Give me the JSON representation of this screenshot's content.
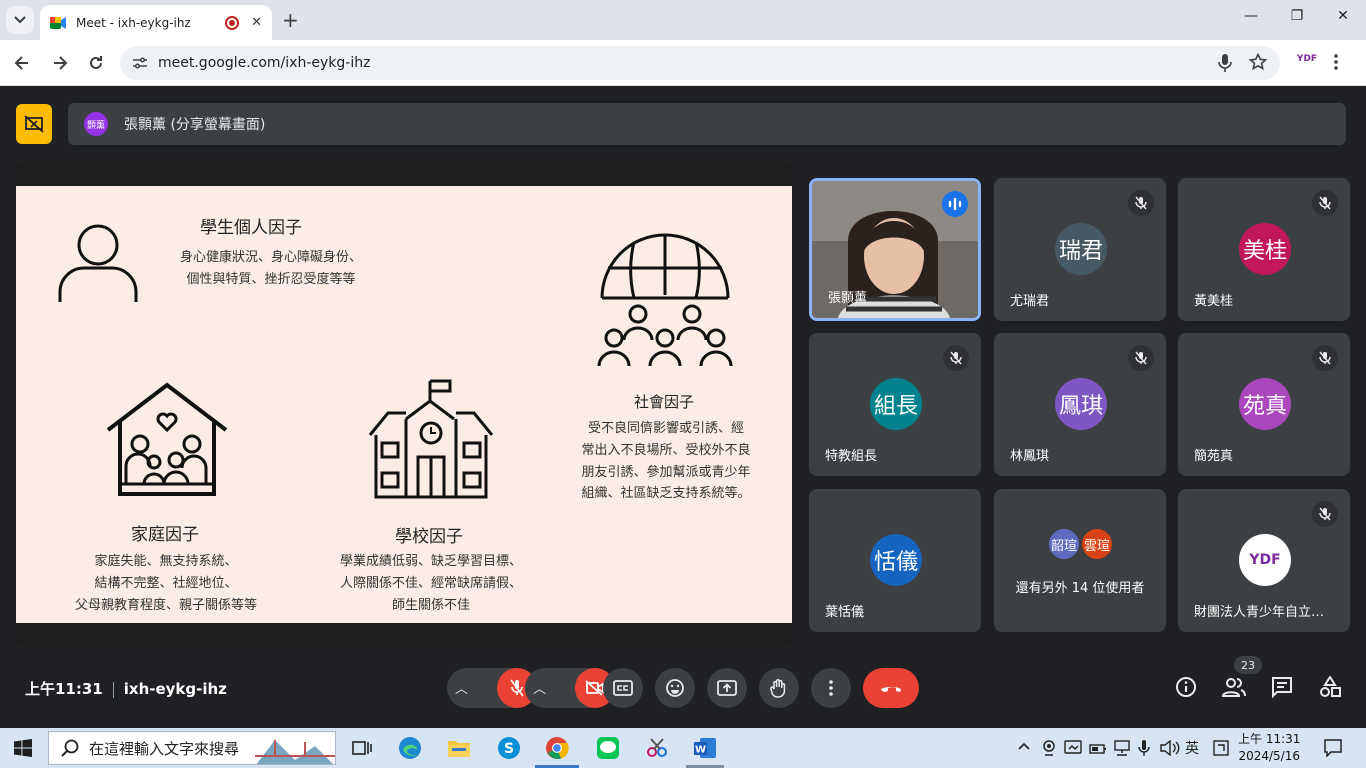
{
  "browser": {
    "tab_title": "Meet - ixh-eykg-ihz",
    "url": "meet.google.com/ixh-eykg-ihz",
    "close_glyph": "✕",
    "new_tab_glyph": "+",
    "profile_label": "YDF"
  },
  "window_controls": {
    "minimize": "—",
    "maximize": "❐",
    "close": "✕"
  },
  "meet": {
    "presenter_avatar": "顥薰",
    "presenter_label": "張顥薰 (分享螢幕畫面)",
    "meeting_time": "上午11:31",
    "meeting_code": "ixh-eykg-ihz",
    "participant_count": "23"
  },
  "slide": {
    "personal": {
      "title": "學生個人因子",
      "line1": "身心健康狀況、身心障礙身份、",
      "line2": "個性與特質、挫折忍受度等等"
    },
    "social": {
      "title": "社會因子",
      "line1": "受不良同儕影響或引誘、經",
      "line2": "常出入不良場所、受校外不良",
      "line3": "朋友引誘、參加幫派或青少年",
      "line4": "組織、社區缺乏支持系統等。"
    },
    "family": {
      "title": "家庭因子",
      "line1": "家庭失能、無支持系統、",
      "line2": "結構不完整、社經地位、",
      "line3": "父母親教育程度、親子關係等等"
    },
    "school": {
      "title": "學校因子",
      "line1": "學業成績低弱、缺乏學習目標、",
      "line2": "人際關係不佳、經常缺席請假、",
      "line3": "師生關係不佳"
    }
  },
  "participants": [
    {
      "name": "張顥薰",
      "video": true
    },
    {
      "name": "尤瑞君",
      "avatar": "瑞君",
      "color": "#455a64"
    },
    {
      "name": "黃美桂",
      "avatar": "美桂",
      "color": "#c2185b"
    },
    {
      "name": "特教組長",
      "avatar": "組長",
      "color": "#00838f"
    },
    {
      "name": "林鳳琪",
      "avatar": "鳳琪",
      "color": "#7e57c2"
    },
    {
      "name": "簡苑真",
      "avatar": "苑真",
      "color": "#ab47bc"
    },
    {
      "name": "葉恬儀",
      "avatar": "恬儀",
      "color": "#1565c0"
    },
    {
      "name": "還有另外 14 位使用者",
      "mini1": "韶瑄",
      "mini2": "雲瑄"
    },
    {
      "name": "財團法人青少年自立…",
      "logo": "YDF"
    }
  ],
  "taskbar": {
    "search_placeholder": "在這裡輸入文字來搜尋",
    "ime": "英",
    "time": "上午 11:31",
    "date": "2024/5/16"
  }
}
